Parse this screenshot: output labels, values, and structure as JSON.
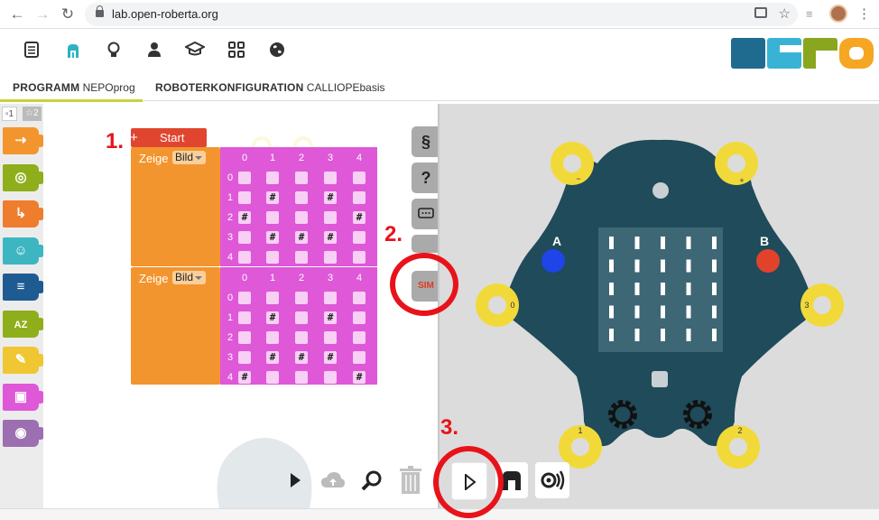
{
  "browser": {
    "url": "lab.open-roberta.org"
  },
  "header": {
    "icons": [
      "program-icon",
      "robot-icon",
      "lightbulb-icon",
      "user-icon",
      "graduation-icon",
      "grid-icon",
      "globe-icon"
    ],
    "logo_colors": [
      "#1f6b8f",
      "#38b3d6",
      "#8aa61f",
      "#f5a623"
    ]
  },
  "tabs": {
    "program_key": "PROGRAMM",
    "program_val": "NEPOprog",
    "config_key": "ROBOTERKONFIGURATION",
    "config_val": "CALLIOPEbasis"
  },
  "palette": {
    "toggle_basic": "1",
    "toggle_expert": "2",
    "categories": [
      {
        "name": "action",
        "color": "#f3952e"
      },
      {
        "name": "sensors",
        "color": "#8fae1b"
      },
      {
        "name": "control",
        "color": "#ee7d2e"
      },
      {
        "name": "logic",
        "color": "#3db6c2"
      },
      {
        "name": "math",
        "color": "#1f5b93"
      },
      {
        "name": "text",
        "color": "#8fae1b"
      },
      {
        "name": "colour",
        "color": "#f0c632"
      },
      {
        "name": "image",
        "color": "#de58d8"
      },
      {
        "name": "communication",
        "color": "#9b6fb0"
      }
    ]
  },
  "blocks": {
    "start_label": "Start",
    "show_label": "Zeige",
    "image_option": "Bild",
    "col_headers": [
      "0",
      "1",
      "2",
      "3",
      "4"
    ],
    "row_headers": [
      "0",
      "1",
      "2",
      "3",
      "4"
    ],
    "image1": [
      [
        " ",
        " ",
        " ",
        " ",
        " "
      ],
      [
        " ",
        "#",
        " ",
        "#",
        " "
      ],
      [
        "#",
        " ",
        " ",
        " ",
        "#"
      ],
      [
        " ",
        "#",
        "#",
        "#",
        " "
      ],
      [
        " ",
        " ",
        " ",
        " ",
        " "
      ]
    ],
    "image2": [
      [
        " ",
        " ",
        " ",
        " ",
        " "
      ],
      [
        " ",
        "#",
        " ",
        "#",
        " "
      ],
      [
        " ",
        " ",
        " ",
        " ",
        " "
      ],
      [
        " ",
        "#",
        "#",
        "#",
        " "
      ],
      [
        "#",
        " ",
        " ",
        " ",
        "#"
      ]
    ]
  },
  "sidebar": {
    "code_label": "§",
    "help_label": "?",
    "sim_label": "SIM"
  },
  "simulator": {
    "board_color": "#1f4b5a",
    "pad_color": "#f2d93a",
    "button_a_label": "A",
    "button_b_label": "B",
    "pad_minus_label": "−",
    "pad_plus_label": "+",
    "pad0_label": "0",
    "pad1_label": "1",
    "pad2_label": "2",
    "pad3_label": "3"
  },
  "annotations": {
    "step1": "1.",
    "step2": "2.",
    "step3": "3."
  }
}
